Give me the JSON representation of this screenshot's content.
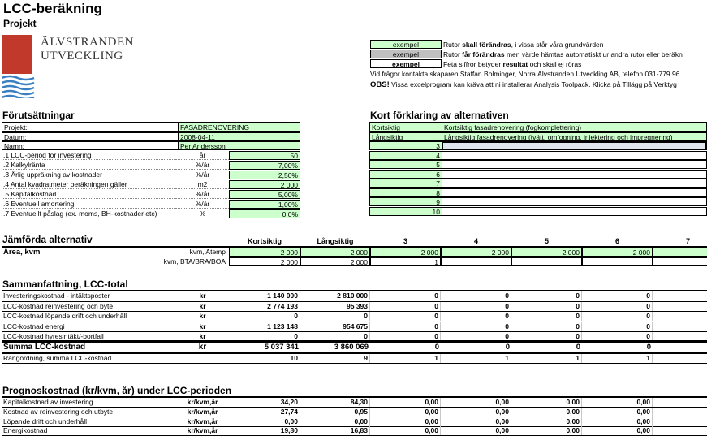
{
  "title": "LCC-beräkning",
  "subtitle": "Projekt",
  "logo": {
    "line1": "ÄLVSTRANDEN",
    "line2": "UTVECKLING",
    "color": "#c0392b",
    "wave_color": "#3a7fc1"
  },
  "legend": [
    {
      "sample": "exempel",
      "text_pre": "Rutor ",
      "text_bold": "skall förändras",
      "text_post": ", i vissa står våra grundvärden"
    },
    {
      "sample": "exempel",
      "text_pre": "Rutor ",
      "text_bold": "får förändras",
      "text_post": " men värde hämtas automatiskt ur andra rutor eller beräkn"
    },
    {
      "sample": "exempel",
      "text_pre": "Feta siffror betyder ",
      "text_bold": "resultat",
      "text_post": "  och skall ej röras"
    }
  ],
  "contact": "Vid frågor kontakta skaparen Staffan Bolminger, Norra Älvstranden Utveckling AB, telefon 031-779 96",
  "obs_label": "OBS!",
  "obs_text": "Vissa excelprogram kan kräva att ni installerar Analysis Toolpack. Klicka på Tillägg på Verktyg",
  "forutsattningar": {
    "heading": "Förutsättningar",
    "info": [
      {
        "label": "Projekt:",
        "value": "FASADRENOVERING"
      },
      {
        "label": "Datum:",
        "value": "2008-04-11"
      },
      {
        "label": "Namn:",
        "value": "Per Andersson"
      }
    ],
    "params": [
      {
        "label": ".1 LCC-period för investering",
        "unit": "år",
        "value": "50"
      },
      {
        "label": ".2 Kalkylränta",
        "unit": "%/år",
        "value": "7,00%"
      },
      {
        "label": ".3 Årlig uppräkning av kostnader",
        "unit": "%/år",
        "value": "2,50%"
      },
      {
        "label": ".4 Antal kvadratmeter beräkningen gäller",
        "unit": "m2",
        "value": "2 000"
      },
      {
        "label": ".5 Kapitalkostnad",
        "unit": "%/år",
        "value": "5,00%"
      },
      {
        "label": ".6 Eventuell amortering",
        "unit": "%/år",
        "value": "1,00%"
      },
      {
        "label": ".7 Eventuellt påslag (ex. moms, BH-kostnader etc)",
        "unit": "%",
        "value": "0,0%"
      }
    ]
  },
  "kort": {
    "heading": "Kort förklaring av alternativen",
    "rows": [
      {
        "label": "Kortsiktig",
        "text": "Kortsiktig fasadrenovering (fogkomplettering)"
      },
      {
        "label": "Långsiktig",
        "text": "Långsiktig fasadrenovering (tvätt, omfogning, injektering och impregnering)"
      }
    ],
    "nums": [
      "3",
      "4",
      "5",
      "6",
      "7",
      "8",
      "9",
      "10"
    ]
  },
  "jamforda": {
    "heading": "Jämförda alternativ",
    "cols": [
      "Kortsiktig",
      "Långsiktig",
      "3",
      "4",
      "5",
      "6",
      "7"
    ],
    "area_label": "Area, kvm",
    "area_unit": "kvm, Atemp",
    "area_values": [
      "2 000",
      "2 000",
      "2 000",
      "2 000",
      "2 000",
      "2 000",
      "2"
    ],
    "bta_unit": "kvm, BTA/BRA/BOA",
    "bta_values": [
      "2 000",
      "2 000",
      "1",
      "",
      "",
      "",
      ""
    ]
  },
  "sammanfattning": {
    "heading": "Sammanfattning, LCC-total",
    "rows": [
      {
        "label": "Investeringskostnad - intäktsposter",
        "unit": "kr",
        "values": [
          "1 140 000",
          "2 810 000",
          "0",
          "0",
          "0",
          "0"
        ]
      },
      {
        "label": "LCC-kostnad reinvestering och byte",
        "unit": "kr",
        "values": [
          "2 774 193",
          "95 393",
          "0",
          "0",
          "0",
          "0"
        ]
      },
      {
        "label": "LCC-kostnad löpande drift och underhåll",
        "unit": "kr",
        "values": [
          "0",
          "0",
          "0",
          "0",
          "0",
          "0"
        ]
      },
      {
        "label": "LCC-kostnad energi",
        "unit": "kr",
        "values": [
          "1 123 148",
          "954 675",
          "0",
          "0",
          "0",
          "0"
        ]
      },
      {
        "label": "LCC-kostnad hyresintäkt/-bortfall",
        "unit": "kr",
        "values": [
          "0",
          "0",
          "0",
          "0",
          "0",
          "0"
        ]
      }
    ],
    "sum_label": "Summa LCC-kostnad",
    "sum_unit": "kr",
    "sum_values": [
      "5 037 341",
      "3 860 069",
      "0",
      "0",
      "0",
      "0"
    ],
    "rank_label": "Rangordning, summa LCC-kostnad",
    "rank_values": [
      "10",
      "9",
      "1",
      "1",
      "1",
      "1"
    ]
  },
  "prognos": {
    "heading": "Prognoskostnad (kr/kvm, år) under LCC-perioden",
    "rows": [
      {
        "label": "Kapitalkostnad av investering",
        "unit": "kr/kvm,år",
        "values": [
          "34,20",
          "84,30",
          "0,00",
          "0,00",
          "0,00",
          "0,00"
        ]
      },
      {
        "label": "Kostnad av reinvestering och utbyte",
        "unit": "kr/kvm,år",
        "values": [
          "27,74",
          "0,95",
          "0,00",
          "0,00",
          "0,00",
          "0,00"
        ]
      },
      {
        "label": "Löpande drift och underhåll",
        "unit": "kr/kvm,år",
        "values": [
          "0,00",
          "0,00",
          "0,00",
          "0,00",
          "0,00",
          "0,00"
        ]
      },
      {
        "label": "Energikostnad",
        "unit": "kr/kvm,år",
        "values": [
          "19,80",
          "16,83",
          "0,00",
          "0,00",
          "0,00",
          "0,00"
        ]
      }
    ]
  }
}
